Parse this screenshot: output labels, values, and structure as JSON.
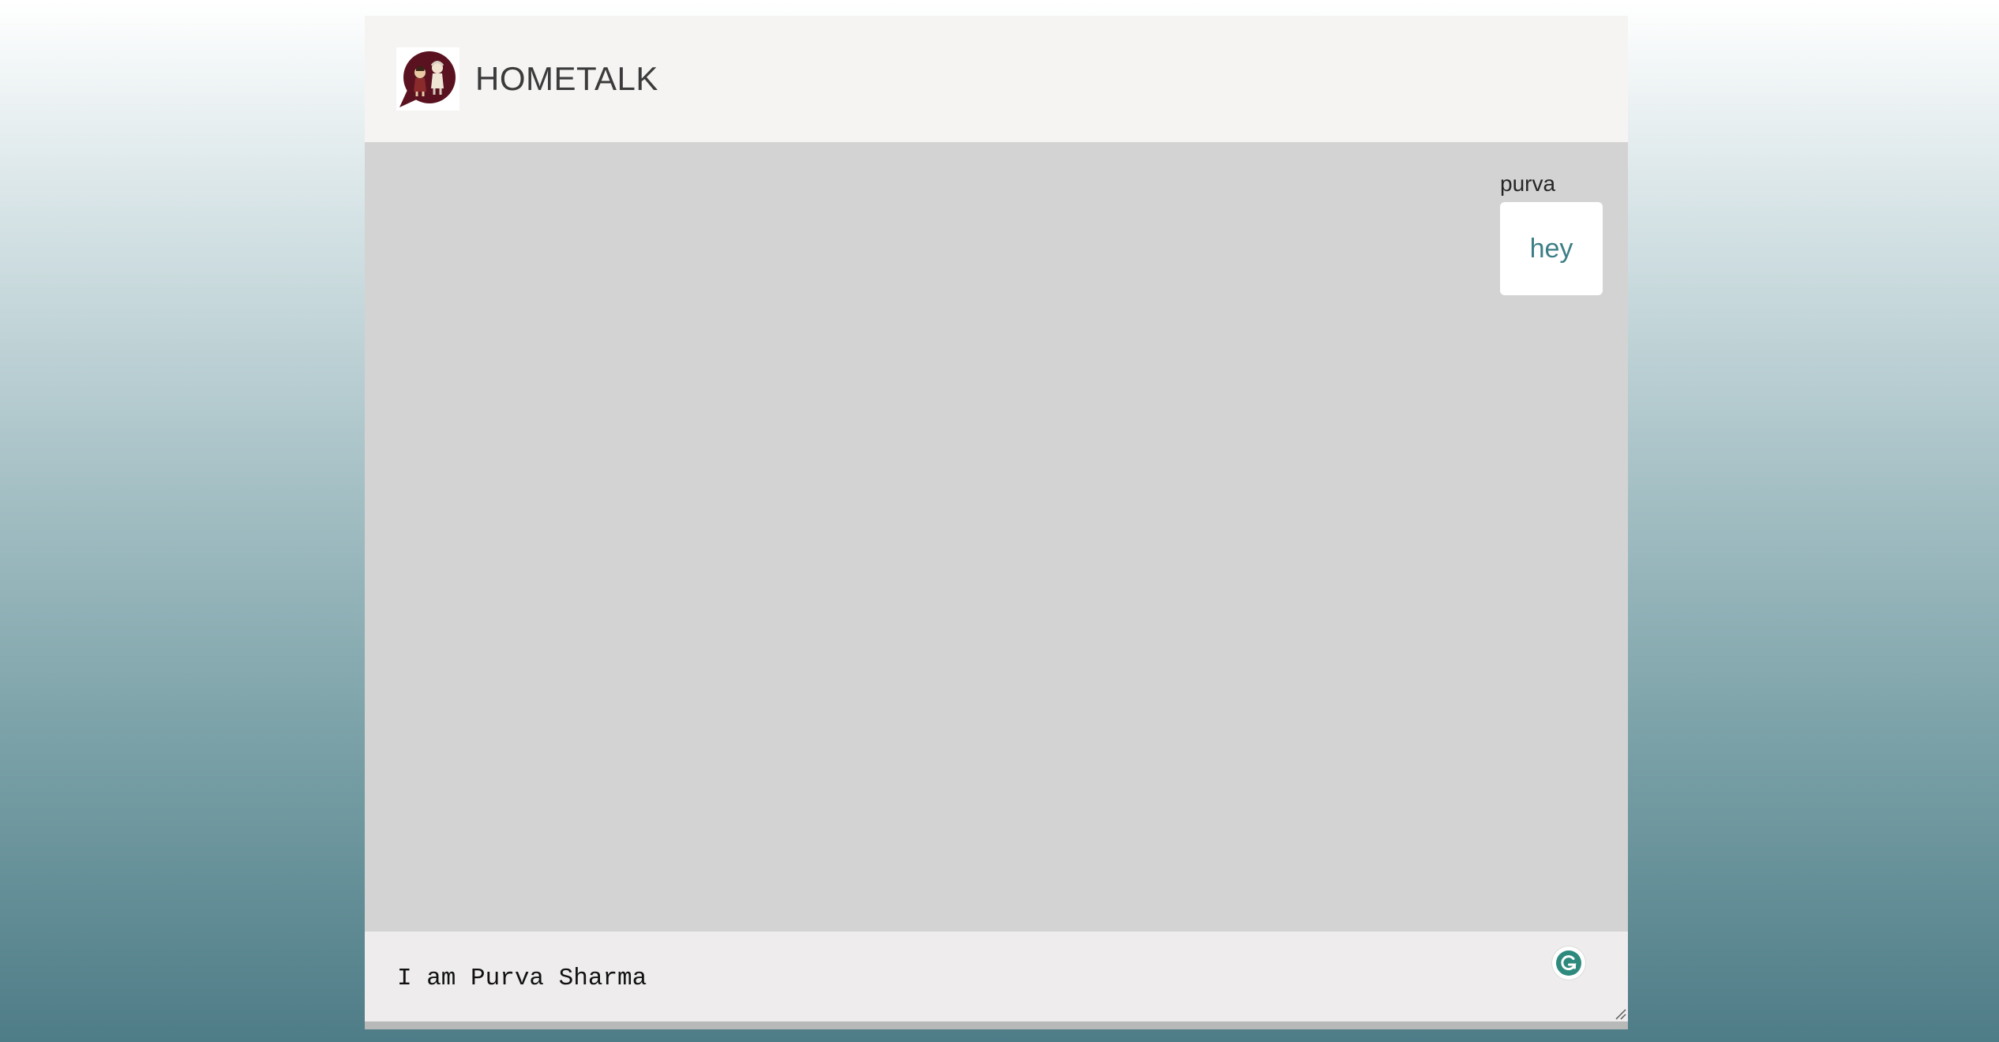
{
  "header": {
    "title": "HOMETALK",
    "logo_icon": "speech-bubble-logo-icon"
  },
  "messages": [
    {
      "sender": "purva",
      "text": "hey"
    }
  ],
  "composer": {
    "value": "I am Purva Sharma",
    "assistant_icon": "grammarly-icon",
    "resize_icon": "resize-handle-icon"
  },
  "colors": {
    "header_bg": "#f5f4f3",
    "chat_bg": "#d3d3d3",
    "bubble_bg": "#ffffff",
    "bubble_text": "#3d7e86",
    "composer_bg": "#eeecec",
    "logo_bubble": "#5a1220",
    "assistant_icon": "#2f8a7e"
  }
}
